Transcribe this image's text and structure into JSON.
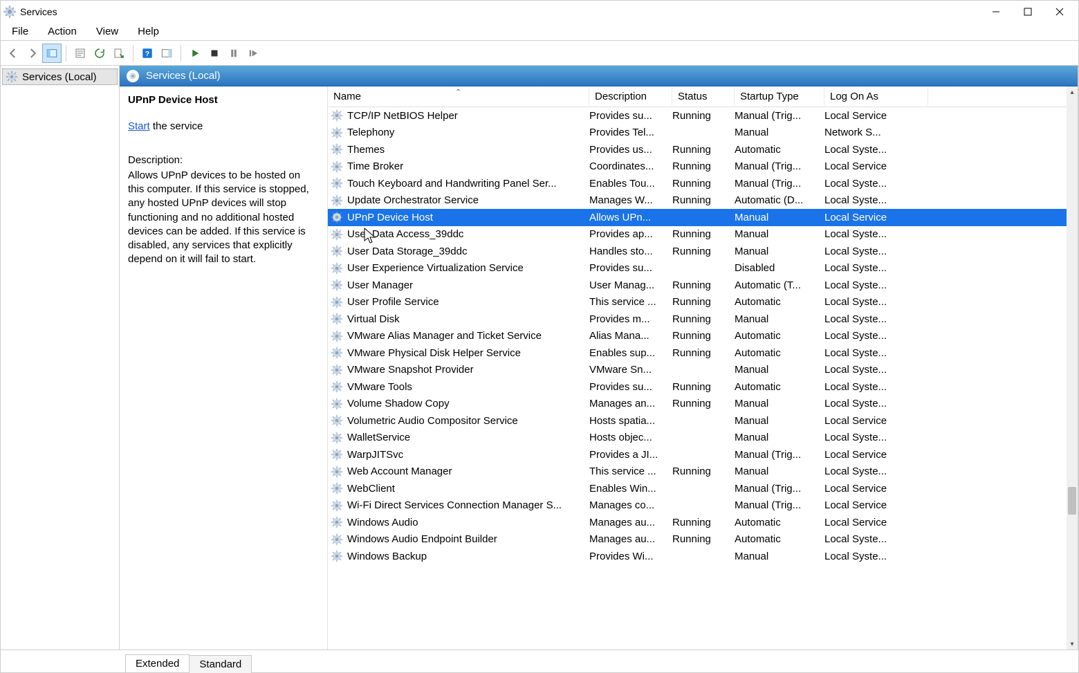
{
  "window": {
    "title": "Services"
  },
  "menubar": [
    "File",
    "Action",
    "View",
    "Help"
  ],
  "tree": {
    "root": "Services (Local)"
  },
  "content_header": "Services (Local)",
  "detail": {
    "service_name": "UPnP Device Host",
    "start_label": "Start",
    "start_suffix": "the service",
    "description_label": "Description:",
    "description_text": "Allows UPnP devices to be hosted on this computer. If this service is stopped, any hosted UPnP devices will stop functioning and no additional hosted devices can be added. If this service is disabled, any services that explicitly depend on it will fail to start."
  },
  "columns": [
    "Name",
    "Description",
    "Status",
    "Startup Type",
    "Log On As"
  ],
  "services": [
    {
      "name": "TCP/IP NetBIOS Helper",
      "description": "Provides su...",
      "status": "Running",
      "startup": "Manual (Trig...",
      "logon": "Local Service",
      "selected": false
    },
    {
      "name": "Telephony",
      "description": "Provides Tel...",
      "status": "",
      "startup": "Manual",
      "logon": "Network S...",
      "selected": false
    },
    {
      "name": "Themes",
      "description": "Provides us...",
      "status": "Running",
      "startup": "Automatic",
      "logon": "Local Syste...",
      "selected": false
    },
    {
      "name": "Time Broker",
      "description": "Coordinates...",
      "status": "Running",
      "startup": "Manual (Trig...",
      "logon": "Local Service",
      "selected": false
    },
    {
      "name": "Touch Keyboard and Handwriting Panel Ser...",
      "description": "Enables Tou...",
      "status": "Running",
      "startup": "Manual (Trig...",
      "logon": "Local Syste...",
      "selected": false
    },
    {
      "name": "Update Orchestrator Service",
      "description": "Manages W...",
      "status": "Running",
      "startup": "Automatic (D...",
      "logon": "Local Syste...",
      "selected": false
    },
    {
      "name": "UPnP Device Host",
      "description": "Allows UPn...",
      "status": "",
      "startup": "Manual",
      "logon": "Local Service",
      "selected": true
    },
    {
      "name": "User Data Access_39ddc",
      "description": "Provides ap...",
      "status": "Running",
      "startup": "Manual",
      "logon": "Local Syste...",
      "selected": false
    },
    {
      "name": "User Data Storage_39ddc",
      "description": "Handles sto...",
      "status": "Running",
      "startup": "Manual",
      "logon": "Local Syste...",
      "selected": false
    },
    {
      "name": "User Experience Virtualization Service",
      "description": "Provides su...",
      "status": "",
      "startup": "Disabled",
      "logon": "Local Syste...",
      "selected": false
    },
    {
      "name": "User Manager",
      "description": "User Manag...",
      "status": "Running",
      "startup": "Automatic (T...",
      "logon": "Local Syste...",
      "selected": false
    },
    {
      "name": "User Profile Service",
      "description": "This service ...",
      "status": "Running",
      "startup": "Automatic",
      "logon": "Local Syste...",
      "selected": false
    },
    {
      "name": "Virtual Disk",
      "description": "Provides m...",
      "status": "Running",
      "startup": "Manual",
      "logon": "Local Syste...",
      "selected": false
    },
    {
      "name": "VMware Alias Manager and Ticket Service",
      "description": "Alias Mana...",
      "status": "Running",
      "startup": "Automatic",
      "logon": "Local Syste...",
      "selected": false
    },
    {
      "name": "VMware Physical Disk Helper Service",
      "description": "Enables sup...",
      "status": "Running",
      "startup": "Automatic",
      "logon": "Local Syste...",
      "selected": false
    },
    {
      "name": "VMware Snapshot Provider",
      "description": "VMware Sn...",
      "status": "",
      "startup": "Manual",
      "logon": "Local Syste...",
      "selected": false
    },
    {
      "name": "VMware Tools",
      "description": "Provides su...",
      "status": "Running",
      "startup": "Automatic",
      "logon": "Local Syste...",
      "selected": false
    },
    {
      "name": "Volume Shadow Copy",
      "description": "Manages an...",
      "status": "Running",
      "startup": "Manual",
      "logon": "Local Syste...",
      "selected": false
    },
    {
      "name": "Volumetric Audio Compositor Service",
      "description": "Hosts spatia...",
      "status": "",
      "startup": "Manual",
      "logon": "Local Service",
      "selected": false
    },
    {
      "name": "WalletService",
      "description": "Hosts objec...",
      "status": "",
      "startup": "Manual",
      "logon": "Local Syste...",
      "selected": false
    },
    {
      "name": "WarpJITSvc",
      "description": "Provides a JI...",
      "status": "",
      "startup": "Manual (Trig...",
      "logon": "Local Service",
      "selected": false
    },
    {
      "name": "Web Account Manager",
      "description": "This service ...",
      "status": "Running",
      "startup": "Manual",
      "logon": "Local Syste...",
      "selected": false
    },
    {
      "name": "WebClient",
      "description": "Enables Win...",
      "status": "",
      "startup": "Manual (Trig...",
      "logon": "Local Service",
      "selected": false
    },
    {
      "name": "Wi-Fi Direct Services Connection Manager S...",
      "description": "Manages co...",
      "status": "",
      "startup": "Manual (Trig...",
      "logon": "Local Service",
      "selected": false
    },
    {
      "name": "Windows Audio",
      "description": "Manages au...",
      "status": "Running",
      "startup": "Automatic",
      "logon": "Local Service",
      "selected": false
    },
    {
      "name": "Windows Audio Endpoint Builder",
      "description": "Manages au...",
      "status": "Running",
      "startup": "Automatic",
      "logon": "Local Syste...",
      "selected": false
    },
    {
      "name": "Windows Backup",
      "description": "Provides Wi...",
      "status": "",
      "startup": "Manual",
      "logon": "Local Syste...",
      "selected": false
    }
  ],
  "tabs": {
    "extended": "Extended",
    "standard": "Standard",
    "active": "extended"
  }
}
